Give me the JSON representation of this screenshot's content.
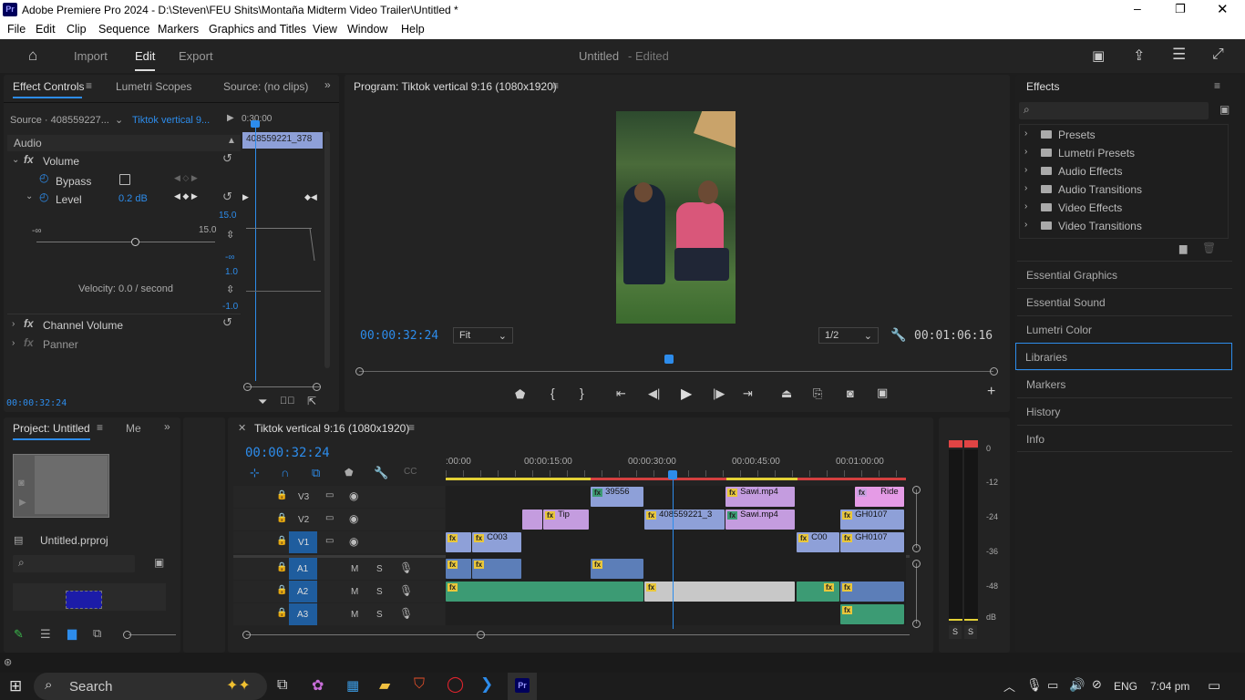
{
  "titlebar": {
    "app_icon": "Pr",
    "title": "Adobe Premiere Pro 2024 - D:\\Steven\\FEU Shits\\Montaña Midterm Video Trailer\\Untitled *"
  },
  "menu": [
    "File",
    "Edit",
    "Clip",
    "Sequence",
    "Markers",
    "Graphics and Titles",
    "View",
    "Window",
    "Help"
  ],
  "header": {
    "tabs": [
      "Import",
      "Edit",
      "Export"
    ],
    "project": "Untitled",
    "status": "- Edited"
  },
  "effect_controls": {
    "tabs": [
      "Effect Controls",
      "Lumetri Scopes",
      "Source: (no clips)"
    ],
    "source_label": "Source · 408559227...",
    "sequence_label": "Tiktok vertical 9...",
    "mini_time": "0:30:00",
    "mini_clip": "408559221_378",
    "section": "Audio",
    "volume": "Volume",
    "bypass": "Bypass",
    "level": "Level",
    "level_value": "0.2 dB",
    "scale_top": "15.0",
    "scale_bottom": "-∞",
    "slider_left": "-∞",
    "slider_right": "15.0",
    "vel_top": "1.0",
    "vel_bottom": "-1.0",
    "velocity": "Velocity: 0.0 / second",
    "channel_volume": "Channel Volume",
    "panner": "Panner",
    "timecode": "00:00:32:24"
  },
  "program": {
    "title": "Program: Tiktok vertical 9:16 (1080x1920)",
    "timecode": "00:00:32:24",
    "fit": "Fit",
    "quality": "1/2",
    "duration": "00:01:06:16"
  },
  "effects": {
    "title": "Effects",
    "folders": [
      "Presets",
      "Lumetri Presets",
      "Audio Effects",
      "Audio Transitions",
      "Video Effects",
      "Video Transitions"
    ],
    "panels": [
      "Essential Graphics",
      "Essential Sound",
      "Lumetri Color",
      "Libraries",
      "Markers",
      "History",
      "Info"
    ]
  },
  "project": {
    "tab": "Project: Untitled",
    "tab2": "Me",
    "file": "Untitled.prproj"
  },
  "timeline": {
    "title": "Tiktok vertical 9:16 (1080x1920)",
    "timecode": "00:00:32:24",
    "ruler": [
      ":00:00",
      "00:00:15:00",
      "00:00:30:00",
      "00:00:45:00",
      "00:01:00:00"
    ],
    "video_tracks": [
      "V3",
      "V2",
      "V1"
    ],
    "audio_tracks": [
      "A1",
      "A2",
      "A3"
    ],
    "clips": {
      "v3a": "39556",
      "v3b": "Sawi.mp4",
      "v3c": "Ride",
      "v2a": "Tip",
      "v2b": "408559221_3",
      "v2c": "Sawi.mp4",
      "v2d": "GH0107",
      "v1a": "C003",
      "v1b": "C00",
      "v1c": "GH0107"
    },
    "m": "M",
    "s": "S"
  },
  "meter": {
    "scale": [
      "0",
      "-12",
      "-24",
      "-36",
      "-48",
      "dB"
    ],
    "solo": [
      "S",
      "S"
    ]
  },
  "taskbar": {
    "search": "Search",
    "lang": "ENG",
    "time": "7:04 pm"
  }
}
